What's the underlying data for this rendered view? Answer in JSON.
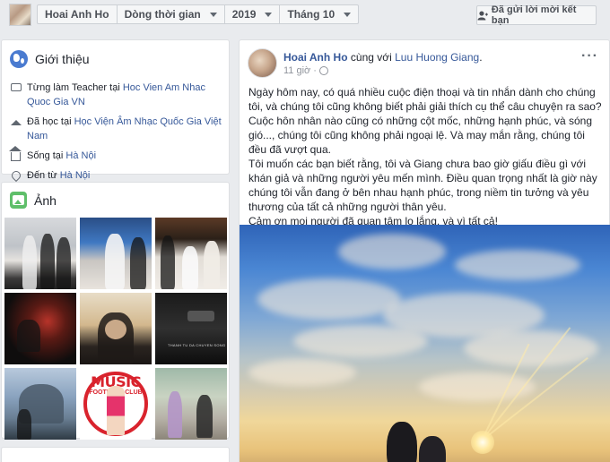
{
  "topbar": {
    "profile_name": "Hoai Anh Ho",
    "filters": [
      "Dòng thời gian",
      "2019",
      "Tháng 10"
    ],
    "friend_request_button": "Đã gửi lời mời kết bạn"
  },
  "intro": {
    "title": "Giới thiệu",
    "items": [
      {
        "icon": "briefcase-icon",
        "prefix": "Từng làm Teacher tại ",
        "link": "Hoc Vien Am Nhac Quoc Gia VN"
      },
      {
        "icon": "graduation-cap-icon",
        "prefix": "Đã học tại ",
        "link": "Học Viện Âm Nhạc Quốc Gia Việt Nam"
      },
      {
        "icon": "home-icon",
        "prefix": "Sống tại ",
        "link": "Hà Nội"
      },
      {
        "icon": "location-pin-icon",
        "prefix": "Đến từ ",
        "link": "Hà Nội"
      }
    ]
  },
  "photos": {
    "title": "Ảnh",
    "music_badge": {
      "line1": "MUSIC",
      "line2": "FOOTBALL CLUB"
    },
    "dark_caption": "THANH TU DA CHUYEN SONG"
  },
  "post": {
    "author": "Hoai Anh Ho",
    "with_text": " cùng với ",
    "tagged": "Luu Huong Giang",
    "time": "11 giờ",
    "privacy_icon": "globe-icon",
    "paragraphs": [
      "Ngày hôm nay, có quá nhiều cuộc điện thoại và tin nhắn dành cho chúng tôi, và chúng tôi cũng không biết phải giải thích cụ thể câu chuyện ra sao? Cuộc hôn nhân nào cũng có những cột mốc, những hạnh phúc, và sóng gió..., chúng tôi cũng không phải ngoại lệ. Và may mắn rằng, chúng tôi đều đã vượt qua.",
      "Tôi muốn các bạn biết rằng, tôi và Giang chưa bao giờ giấu điều gì với khán giả và những người yêu mến mình. Điều quan trọng nhất là giờ này chúng tôi vẫn đang ở bên nhau hạnh phúc, trong niềm tin tưởng và yêu thương của tất cả những người thân yêu.",
      "Cảm ơn mọi người đã quan tâm lo lắng, và vì tất cả!"
    ]
  },
  "colors": {
    "link": "#365899",
    "background": "#e9ebee",
    "meta": "#90949c"
  }
}
